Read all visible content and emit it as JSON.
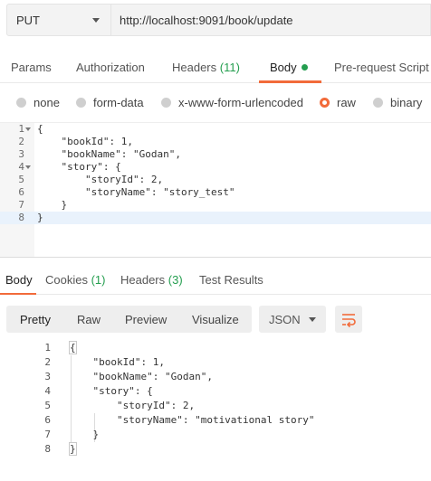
{
  "request": {
    "method": "PUT",
    "url": "http://localhost:9091/book/update"
  },
  "request_tabs": [
    {
      "label": "Params",
      "count": ""
    },
    {
      "label": "Authorization",
      "count": ""
    },
    {
      "label": "Headers",
      "count": "(11)"
    },
    {
      "label": "Body",
      "count": ""
    },
    {
      "label": "Pre-request Script",
      "count": ""
    }
  ],
  "active_request_tab": "Body",
  "body_types": [
    {
      "label": "none",
      "selected": false
    },
    {
      "label": "form-data",
      "selected": false
    },
    {
      "label": "x-www-form-urlencoded",
      "selected": false
    },
    {
      "label": "raw",
      "selected": true
    },
    {
      "label": "binary",
      "selected": false
    }
  ],
  "request_body_lines": [
    {
      "n": "1",
      "text": "{"
    },
    {
      "n": "2",
      "text": "    \"bookId\": 1,"
    },
    {
      "n": "3",
      "text": "    \"bookName\": \"Godan\","
    },
    {
      "n": "4",
      "text": "    \"story\": {"
    },
    {
      "n": "5",
      "text": "        \"storyId\": 2,"
    },
    {
      "n": "6",
      "text": "        \"storyName\": \"story_test\""
    },
    {
      "n": "7",
      "text": "    }"
    },
    {
      "n": "8",
      "text": "}"
    }
  ],
  "response_tabs": [
    {
      "label": "Body",
      "count": ""
    },
    {
      "label": "Cookies",
      "count": "(1)"
    },
    {
      "label": "Headers",
      "count": "(3)"
    },
    {
      "label": "Test Results",
      "count": ""
    }
  ],
  "view_modes": [
    "Pretty",
    "Raw",
    "Preview",
    "Visualize"
  ],
  "active_view_mode": "Pretty",
  "format": "JSON",
  "response_body_lines": [
    {
      "n": "1",
      "text": "{"
    },
    {
      "n": "2",
      "text": "    \"bookId\": 1,"
    },
    {
      "n": "3",
      "text": "    \"bookName\": \"Godan\","
    },
    {
      "n": "4",
      "text": "    \"story\": {"
    },
    {
      "n": "5",
      "text": "        \"storyId\": 2,"
    },
    {
      "n": "6",
      "text": "        \"storyName\": \"motivational story\""
    },
    {
      "n": "7",
      "text": "    }"
    },
    {
      "n": "8",
      "text": "}"
    }
  ],
  "colors": {
    "accent": "#f26b3a",
    "count_green": "#249e4f"
  }
}
